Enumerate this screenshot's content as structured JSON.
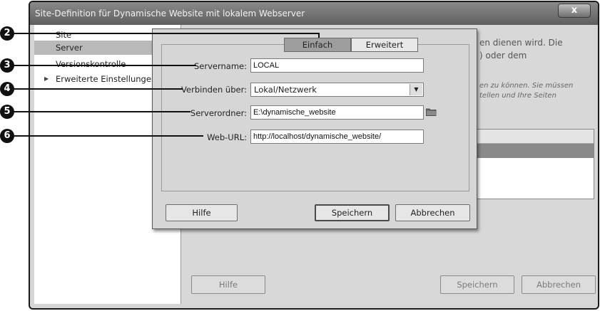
{
  "outer_window": {
    "title": "Site-Definition für Dynamische Website mit lokalem Webserver",
    "close_glyph": "x"
  },
  "sidebar": {
    "items": [
      {
        "label": "Site"
      },
      {
        "label": "Server"
      },
      {
        "label": "Versionskontrolle"
      },
      {
        "label": "Erweiterte Einstellungen"
      }
    ]
  },
  "background": {
    "text_line1": "en dienen wird. Die",
    "text_line2": ") oder dem",
    "italic_line1": "en zu können. Sie müssen",
    "italic_line2": "tellen und Ihre Seiten",
    "help_label": "Hilfe",
    "save_label": "Speichern",
    "cancel_label": "Abbrechen"
  },
  "dialog": {
    "tabs": [
      {
        "label": "Einfach"
      },
      {
        "label": "Erweitert"
      }
    ],
    "fields": {
      "servername_label": "Servername:",
      "servername_value": "LOCAL",
      "connect_label": "Verbinden über:",
      "connect_value": "Lokal/Netzwerk",
      "folder_label": "Serverordner:",
      "folder_value": "E:\\dynamische_website",
      "url_label": "Web-URL:",
      "url_value": "http://localhost/dynamische_website/"
    },
    "buttons": {
      "help": "Hilfe",
      "save": "Speichern",
      "cancel": "Abbrechen"
    }
  },
  "callouts": [
    "2",
    "3",
    "4",
    "5",
    "6"
  ]
}
